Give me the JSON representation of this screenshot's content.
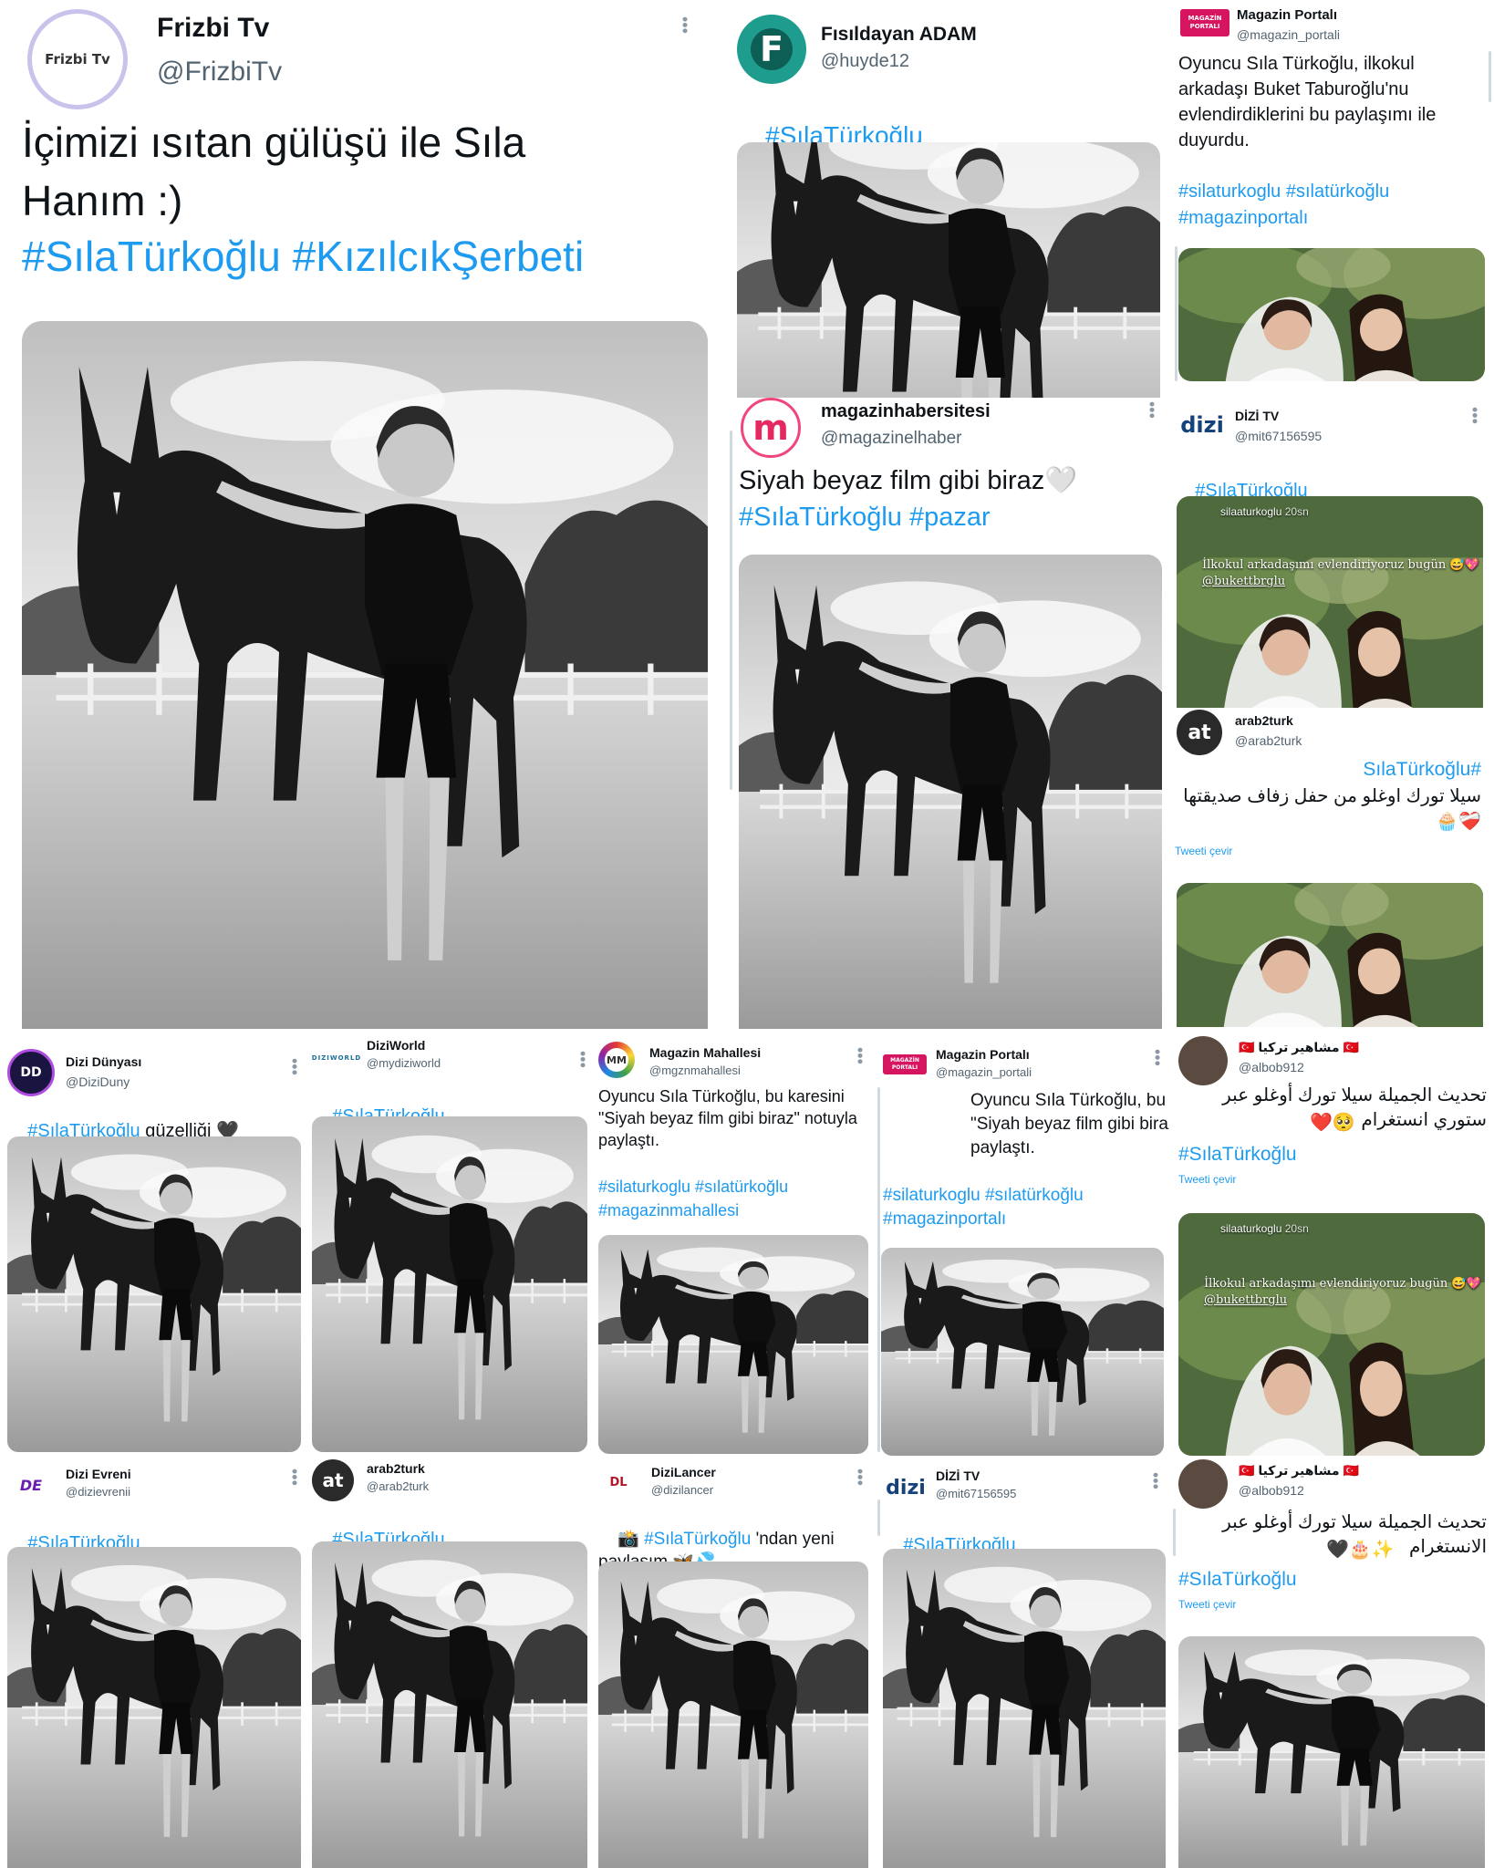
{
  "colors": {
    "link": "#1d9bf0",
    "handle": "#536471",
    "black_heart": "#111111",
    "red_heart": "#d0021b",
    "yellow_heart": "#f5c518"
  },
  "tweets": {
    "frizbi": {
      "name": "Frizbi Tv",
      "handle": "@FrizbiTv",
      "avatar_text": "Frizbi Tv",
      "text": "İçimizi ısıtan gülüşü ile Sıla Hanım :)",
      "tags": "#SılaTürkoğlu #KızılcıkŞerbeti"
    },
    "fisildayan": {
      "name": "Fısıldayan ADAM",
      "handle": "@huyde12",
      "avatar_text": "F",
      "tags": "#SılaTürkoğlu",
      "emoji": "🤍🖤"
    },
    "magazin_portali_1": {
      "name": "Magazin Portalı",
      "handle": "@magazin_portali",
      "avatar_text": "MAGAZİN PORTALI",
      "text": "Oyuncu Sıla Türkoğlu, ilkokul arkadaşı Buket Taburoğlu'nu evlendirdiklerini bu paylaşımı ile duyurdu.",
      "tags": "#silaturkoglu #sılatürkoğlu #magazinportalı"
    },
    "magazinhaber": {
      "name": "magazinhabersitesi",
      "handle": "@magazinelhaber",
      "avatar_text": "m",
      "text": "Siyah beyaz film gibi biraz🤍",
      "tags": "#SılaTürkoğlu #pazar"
    },
    "dizitv_1": {
      "name": "DİZİ TV",
      "handle": "@mit67156595",
      "avatar_text": "dizi",
      "tags": "#SılaTürkoğlu",
      "emoji": "❤️❤️❤️",
      "story_user": "silaaturkoglu",
      "story_time": "20sn",
      "story_caption": "İlkokul arkadaşımı evlendiriyoruz bugün 😅💖",
      "story_mention": "@bukettbrglu"
    },
    "arab2turk_1": {
      "name": "arab2turk",
      "handle": "@arab2turk",
      "avatar_text": "at",
      "tags": "#SılaTürkoğlu",
      "text": "سيلا تورك اوغلو من حفل زفاف صديقتها",
      "emoji": "❤️‍🩹🧁",
      "translate": "Tweeti çevir"
    },
    "dizi_dunyasi": {
      "name": "Dizi Dünyası",
      "handle": "@DiziDuny",
      "avatar_text": "DD",
      "tags": "#SılaTürkoğlu",
      "text": " güzelliği 🖤"
    },
    "diziworld": {
      "name": "DiziWorld",
      "handle": "@mydiziworld",
      "avatar_text": "DIZIWORLD",
      "tags": "#SılaTürkoğlu",
      "emoji": "🖤🤍"
    },
    "magazin_mahallesi": {
      "name": "Magazin Mahallesi",
      "handle": "@mgznmahallesi",
      "avatar_text": "MM",
      "text": "Oyuncu Sıla Türkoğlu, bu karesini \"Siyah beyaz film gibi biraz\" notuyla paylaştı.",
      "tags": "#silaturkoglu #sılatürkoğlu #magazinmahallesi"
    },
    "magazin_portali_2": {
      "name": "Magazin Portalı",
      "handle": "@magazin_portali",
      "avatar_text": "MAGAZİN PORTALI",
      "text": "Oyuncu Sıla Türkoğlu, bu karesini \"Siyah beyaz film gibi biraz\" notuyla paylaştı.",
      "tags": "#silaturkoglu #sılatürkoğlu #magazinportalı"
    },
    "meshahir_1": {
      "name": "مشاهير تركيا",
      "handle": "@albob912",
      "text": "تحديث الجميلة سيلا تورك أوغلو عبر ستوري انستغرام",
      "emoji": "❤️🥺",
      "tags": "#SılaTürkoğlu",
      "translate": "Tweeti çevir",
      "story_user": "silaaturkoglu",
      "story_time": "20sn",
      "story_caption": "İlkokul arkadaşımı evlendiriyoruz bugün 😅💖",
      "story_mention": "@bukettbrglu"
    },
    "dizi_evreni": {
      "name": "Dizi Evreni",
      "handle": "@dizievrenii",
      "avatar_text": "DE",
      "tags": "#SılaTürkoğlu",
      "emoji": "🤍🖤"
    },
    "arab2turk_2": {
      "name": "arab2turk",
      "handle": "@arab2turk",
      "avatar_text": "at",
      "tags": "#SılaTürkoğlu",
      "emoji": "💛"
    },
    "dizilancer": {
      "name": "DiziLancer",
      "handle": "@dizilancer",
      "avatar_text": "DL",
      "prefix": "📸 ",
      "tags": "#SılaTürkoğlu",
      "text": " 'ndan yeni paylaşım 🦋💦"
    },
    "dizitv_2": {
      "name": "DİZİ TV",
      "handle": "@mit67156595",
      "avatar_text": "dizi",
      "tags": "#SılaTürkoğlu",
      "emoji": "❤️❤️❤️"
    },
    "meshahir_2": {
      "name": "مشاهير تركيا",
      "handle": "@albob912",
      "text": "تحديث الجميلة سيلا تورك أوغلو عبر الانستغرام",
      "emoji": "🖤🎂✨",
      "tags": "#SılaTürkoğlu",
      "translate": "Tweeti çevir"
    }
  }
}
